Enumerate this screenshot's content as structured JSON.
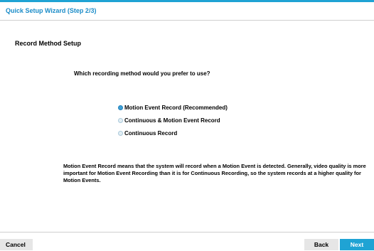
{
  "window": {
    "title": "Quick Setup Wizard (Step 2/3)"
  },
  "section": {
    "title": "Record Method Setup"
  },
  "question": "Which recording method would you prefer to use?",
  "options": [
    {
      "label": "Motion Event Record (Recommended)",
      "selected": true
    },
    {
      "label": "Continuous & Motion Event Record",
      "selected": false
    },
    {
      "label": "Continuous Record",
      "selected": false
    }
  ],
  "description": "Motion Event Record means that the system will record when a Motion Event is detected. Generally, video quality is more important for Motion Event Recording than it is for Continuous Recording, so the system records at a higher quality for Motion Events.",
  "buttons": {
    "cancel": "Cancel",
    "back": "Back",
    "next": "Next"
  },
  "colors": {
    "accent": "#1fa3d4",
    "title_text": "#1a8cc8",
    "button_gray": "#e6e6e6"
  }
}
